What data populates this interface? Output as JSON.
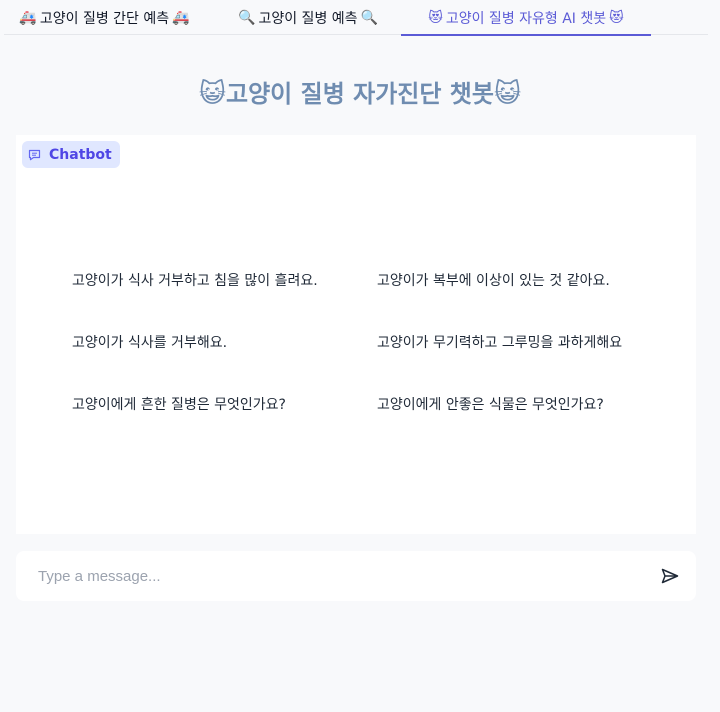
{
  "tabs": [
    {
      "label": "고양이 질병 간단 예측",
      "icon_left": "🚑",
      "icon_right": "🚑",
      "active": false
    },
    {
      "label": "고양이 질병 예측",
      "icon_left": "🔍",
      "icon_right": "🔍",
      "active": false
    },
    {
      "label": "고양이 질병 자유형 AI 챗봇",
      "icon_left": "😻",
      "icon_right": "😻",
      "active": true
    }
  ],
  "page": {
    "title": "고양이 질병 자가진단 챗봇",
    "title_icon": "😺",
    "accent_color": "#5b5bd6",
    "title_color": "#6f8cb0"
  },
  "chatbot": {
    "label": "Chatbot",
    "label_icon": "chat-bubble-icon",
    "examples": [
      "고양이가 식사 거부하고 침을 많이 흘려요.",
      "고양이가 복부에 이상이 있는 것 같아요.",
      "고양이가 식사를 거부해요.",
      "고양이가 무기력하고 그루밍을 과하게해요",
      "고양이에게 흔한 질병은 무엇인가요?",
      "고양이에게 안좋은 식물은 무엇인가요?"
    ]
  },
  "composer": {
    "placeholder": "Type a message...",
    "value": "",
    "send_icon": "send-icon"
  }
}
